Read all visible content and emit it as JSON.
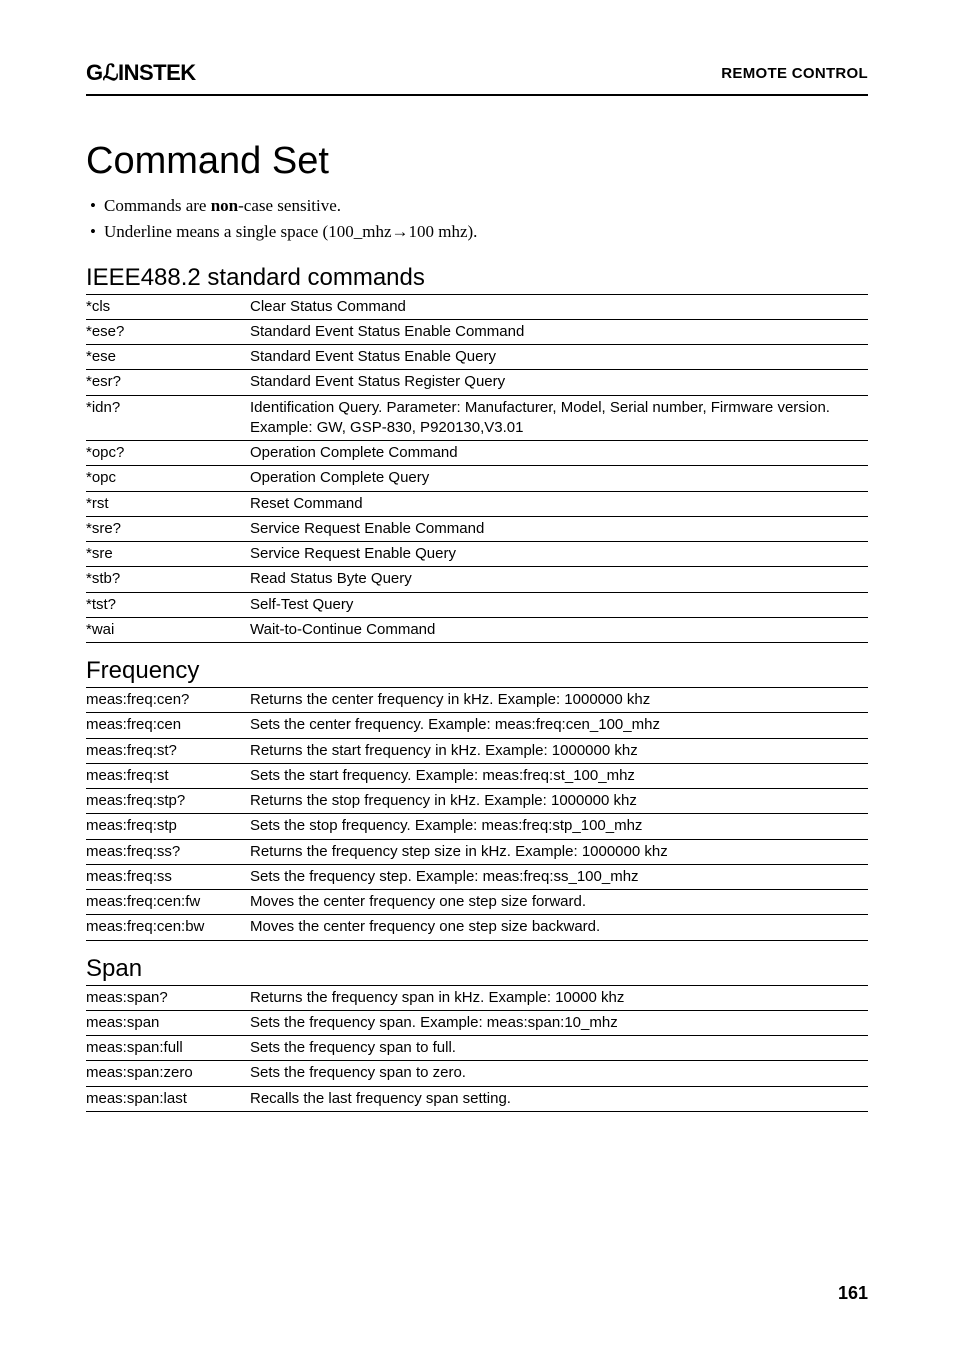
{
  "header": {
    "logo": "GℒINSTEK",
    "section": "REMOTE CONTROL"
  },
  "title": "Command Set",
  "notes": [
    {
      "pre": "Commands are ",
      "bold": "non",
      "post": "-case sensitive."
    },
    {
      "pre": "Underline means a single space (100_mhz→100 mhz).",
      "bold": "",
      "post": ""
    }
  ],
  "sections": [
    {
      "heading": "IEEE488.2 standard commands",
      "rows": [
        {
          "k": "*cls",
          "d": "Clear Status Command"
        },
        {
          "k": "*ese?",
          "d": "Standard Event Status Enable Command"
        },
        {
          "k": "*ese",
          "d": "Standard Event Status Enable Query"
        },
        {
          "k": "*esr?",
          "d": "Standard Event Status Register Query"
        },
        {
          "k": "*idn?",
          "d": "Identification Query. Parameter: Manufacturer, Model, Serial number, Firmware version. Example: GW, GSP-830, P920130,V3.01"
        },
        {
          "k": "*opc?",
          "d": "Operation Complete Command"
        },
        {
          "k": "*opc",
          "d": "Operation Complete Query"
        },
        {
          "k": "*rst",
          "d": "Reset Command"
        },
        {
          "k": "*sre?",
          "d": "Service Request Enable Command"
        },
        {
          "k": "*sre",
          "d": "Service Request Enable Query"
        },
        {
          "k": "*stb?",
          "d": "Read Status Byte Query"
        },
        {
          "k": "*tst?",
          "d": "Self-Test Query"
        },
        {
          "k": "*wai",
          "d": "Wait-to-Continue Command"
        }
      ]
    },
    {
      "heading": "Frequency",
      "rows": [
        {
          "k": "meas:freq:cen?",
          "d": "Returns the center frequency in kHz. Example: 1000000 khz"
        },
        {
          "k": "meas:freq:cen",
          "d": "Sets the center frequency. Example: meas:freq:cen_100_mhz"
        },
        {
          "k": "meas:freq:st?",
          "d": "Returns the start frequency in kHz. Example: 1000000 khz"
        },
        {
          "k": "meas:freq:st",
          "d": "Sets the start frequency. Example: meas:freq:st_100_mhz"
        },
        {
          "k": "meas:freq:stp?",
          "d": "Returns the stop frequency in kHz. Example: 1000000 khz"
        },
        {
          "k": "meas:freq:stp",
          "d": "Sets the stop frequency. Example: meas:freq:stp_100_mhz"
        },
        {
          "k": "meas:freq:ss?",
          "d": "Returns the frequency step size in kHz. Example: 1000000 khz"
        },
        {
          "k": "meas:freq:ss",
          "d": "Sets the frequency step. Example: meas:freq:ss_100_mhz"
        },
        {
          "k": "meas:freq:cen:fw",
          "d": "Moves the center frequency one step size forward."
        },
        {
          "k": "meas:freq:cen:bw",
          "d": "Moves the center frequency one step size backward."
        }
      ]
    },
    {
      "heading": "Span",
      "rows": [
        {
          "k": "meas:span?",
          "d": "Returns the frequency span in kHz. Example: 10000 khz"
        },
        {
          "k": "meas:span",
          "d": "Sets the frequency span. Example: meas:span:10_mhz"
        },
        {
          "k": "meas:span:full",
          "d": "Sets the frequency span to full."
        },
        {
          "k": "meas:span:zero",
          "d": "Sets the frequency span to zero."
        },
        {
          "k": "meas:span:last",
          "d": "Recalls the last frequency span setting."
        }
      ]
    }
  ],
  "page_num": "161"
}
